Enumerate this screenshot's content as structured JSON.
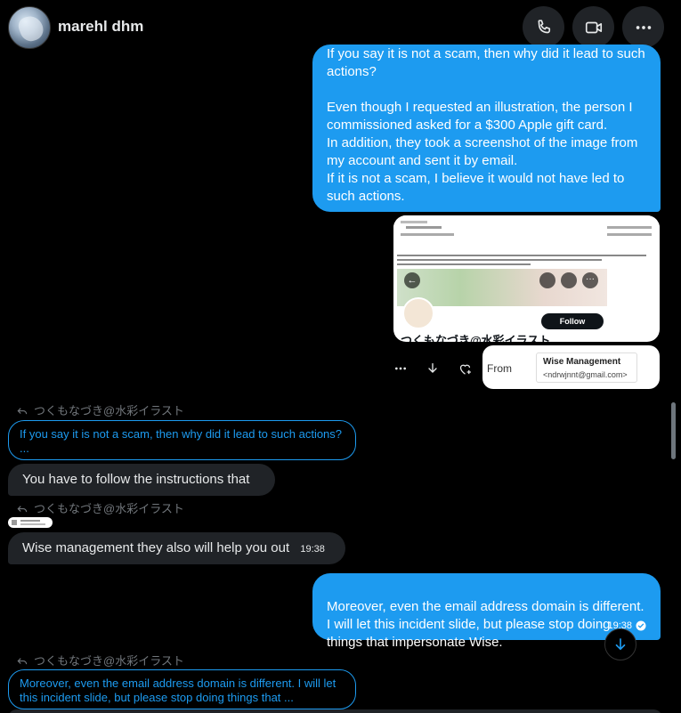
{
  "header": {
    "username": "marehl dhm"
  },
  "icons": {
    "reply": "reply-arrow-icon",
    "phone": "phone-icon",
    "video": "video-icon",
    "more": "more-icon"
  },
  "messages": {
    "m1": {
      "text": "If you say it is not a scam, then why did it lead to such actions?\n\nEven though I requested an illustration, the person I commissioned asked for a $300 Apple gift card.\nIn addition, they took a screenshot of the image from my account and sent it by email.\nIf it is not a scam, I believe it would not have led to such actions."
    },
    "screenshot": {
      "handle": "つくもなづき@水彩イラスト",
      "follow_label": "Follow"
    },
    "email_card": {
      "from_label": "From",
      "sender_name": "Wise Management",
      "sender_email": "<ndrwjnnt@gmail.com>"
    },
    "reply1": {
      "label": "つくもなづき@水彩イラスト",
      "quote": "If you say it is not a scam, then why did it lead to such actions?  ..."
    },
    "m2": {
      "text": "You have to follow the instructions that"
    },
    "reply2": {
      "label": "つくもなづき@水彩イラスト"
    },
    "m3": {
      "text": "Wise management  they also will help you out",
      "time": "19:38"
    },
    "m4": {
      "text": "Moreover, even the email address domain is different. I will let this incident slide, but please stop doing things that impersonate Wise.",
      "time": "19:38"
    },
    "reply3": {
      "label": "つくもなづき@水彩イラスト",
      "quote": "Moreover, even the email address domain is different. I will let this incident slide, but please stop doing things that ..."
    }
  }
}
